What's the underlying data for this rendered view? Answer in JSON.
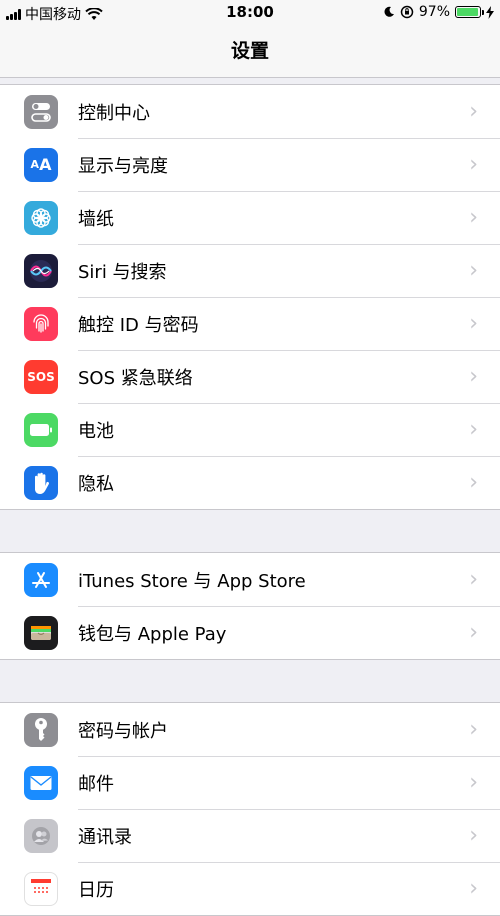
{
  "status_bar": {
    "carrier": "中国移动",
    "time": "18:00",
    "battery_percent": "97%",
    "battery_level": 0.97
  },
  "nav": {
    "title": "设置"
  },
  "groups": [
    {
      "items": [
        {
          "label": "控制中心",
          "icon": "control-center-icon",
          "color": "#8e8e93"
        },
        {
          "label": "显示与亮度",
          "icon": "display-brightness-icon",
          "color": "#1a73e8"
        },
        {
          "label": "墙纸",
          "icon": "wallpaper-icon",
          "color": "#34aadc"
        },
        {
          "label": "Siri 与搜索",
          "icon": "siri-icon",
          "color": "#1c1c3a"
        },
        {
          "label": "触控 ID 与密码",
          "icon": "touch-id-icon",
          "color": "#ff3b5c"
        },
        {
          "label": "SOS 紧急联络",
          "icon": "sos-icon",
          "color": "#ff3b30",
          "icon_text": "SOS"
        },
        {
          "label": "电池",
          "icon": "battery-icon",
          "color": "#4cd964"
        },
        {
          "label": "隐私",
          "icon": "privacy-hand-icon",
          "color": "#1a73e8"
        }
      ]
    },
    {
      "items": [
        {
          "label": "iTunes Store 与 App Store",
          "icon": "app-store-icon",
          "color": "#1a8cff"
        },
        {
          "label": "钱包与 Apple Pay",
          "icon": "wallet-icon",
          "color": "#1c1c1e"
        }
      ]
    },
    {
      "items": [
        {
          "label": "密码与帐户",
          "icon": "key-icon",
          "color": "#8e8e93"
        },
        {
          "label": "邮件",
          "icon": "mail-icon",
          "color": "#1a8cff"
        },
        {
          "label": "通讯录",
          "icon": "contacts-icon",
          "color": "#b0b0b5"
        },
        {
          "label": "日历",
          "icon": "calendar-icon",
          "color": "#ffffff"
        }
      ]
    }
  ]
}
